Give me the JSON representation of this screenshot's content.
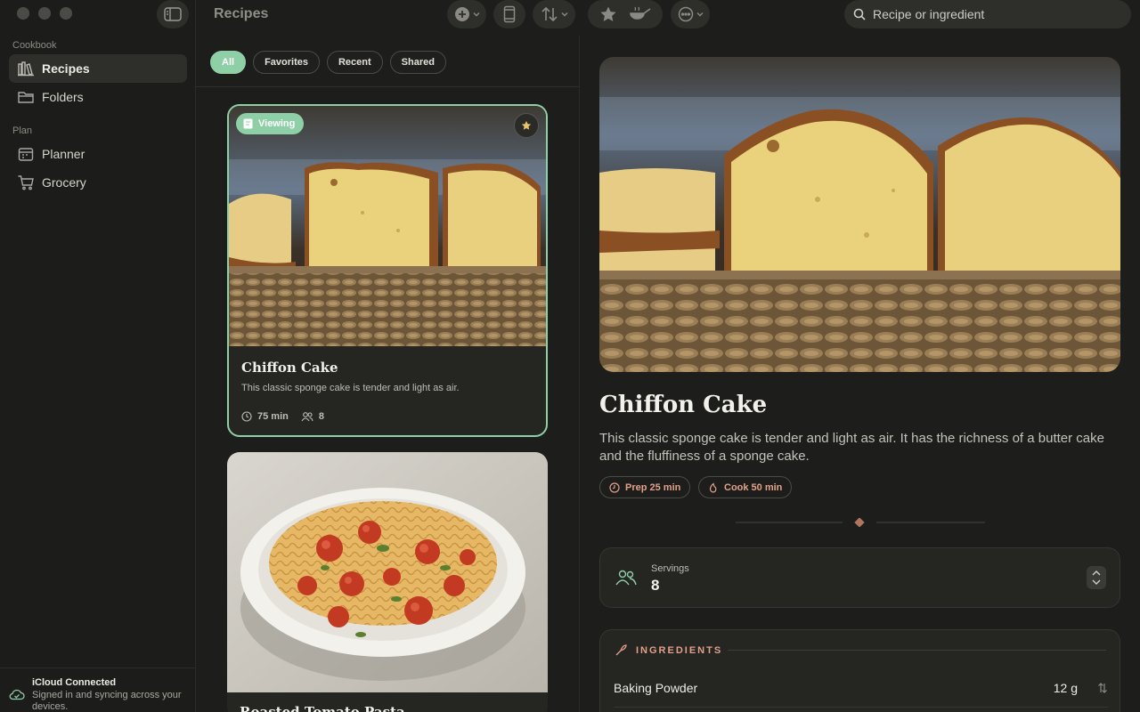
{
  "window": {
    "title": "Recipes"
  },
  "sidebar": {
    "section_cookbook": "Cookbook",
    "section_plan": "Plan",
    "items": [
      {
        "label": "Recipes",
        "icon": "library-icon",
        "active": true
      },
      {
        "label": "Folders",
        "icon": "folder-icon"
      },
      {
        "label": "Planner",
        "icon": "calendar-icon"
      },
      {
        "label": "Grocery",
        "icon": "cart-icon"
      }
    ],
    "icloud": {
      "title": "iCloud Connected",
      "subtitle": "Signed in and syncing across your devices."
    }
  },
  "toolbar": {
    "search_placeholder": "Recipe or ingredient"
  },
  "filters": [
    {
      "label": "All",
      "active": true
    },
    {
      "label": "Favorites"
    },
    {
      "label": "Recent"
    },
    {
      "label": "Shared"
    }
  ],
  "cards": [
    {
      "title": "Chiffon Cake",
      "description": "This classic sponge cake is tender and light as air.",
      "time": "75 min",
      "servings": "8",
      "badge": "Viewing",
      "favorite": true
    },
    {
      "title": "Roasted Tomato Pasta"
    }
  ],
  "detail": {
    "title": "Chiffon Cake",
    "description": "This classic sponge cake is tender and light as air. It has the richness of a butter cake and the fluffiness of a sponge cake.",
    "prep": "Prep 25 min",
    "cook": "Cook 50 min",
    "servings_label": "Servings",
    "servings_value": "8",
    "ingredients_label": "INGREDIENTS",
    "ingredients": [
      {
        "name": "Baking Powder",
        "amount": "12 g"
      }
    ]
  },
  "colors": {
    "accent": "#8fcfa8",
    "warm": "#e2a08a",
    "background": "#1d1e1b"
  }
}
